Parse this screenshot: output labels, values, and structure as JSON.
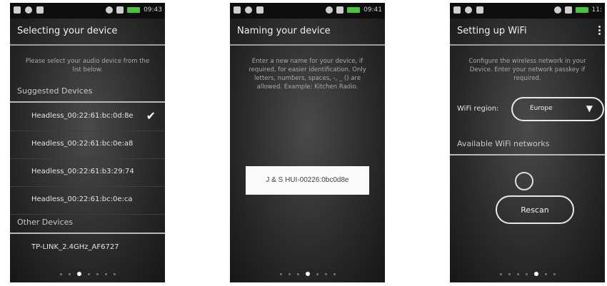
{
  "status_bar": {
    "time1": "09:43",
    "time2": "09:41",
    "time3": "11:"
  },
  "screen1": {
    "title": "Selecting your device",
    "description": "Please select your audio device from the list below.",
    "suggested_header": "Suggested Devices",
    "suggested_devices": [
      {
        "label": "Headless_00:22:61:bc:0d:8e",
        "selected": true
      },
      {
        "label": "Headless_00:22:61:bc:0e:a8",
        "selected": false
      },
      {
        "label": "Headless_00:22:61:b3:29:74",
        "selected": false
      },
      {
        "label": "Headless_00:22:61:bc:0e:ca",
        "selected": false
      }
    ],
    "other_header": "Other Devices",
    "other_devices": [
      {
        "label": "TP-LINK_2.4GHz_AF6727"
      }
    ],
    "page_index": 3,
    "page_count": 7
  },
  "screen2": {
    "title": "Naming your device",
    "description": "Enter a new name for your device, if required, for easier identification. Only letters, numbers, spaces, -, _ () are allowed. Example: Kitchen Radio.",
    "name_value": "J & S HUI-00226:0bc0d8e",
    "page_index": 4,
    "page_count": 7
  },
  "screen3": {
    "title": "Setting up WiFi",
    "description": "Configure the wireless network in your Device. Enter your network passkey if required.",
    "region_label": "WiFi region:",
    "region_value": "Europe",
    "networks_header": "Available WiFi networks",
    "rescan_label": "Rescan",
    "page_index": 5,
    "page_count": 7
  },
  "icons": {
    "check": "✔",
    "dropdown": "▼"
  },
  "colors": {
    "battery": "#49c43f",
    "background": "#2c2c2c",
    "accent": "#ffffff"
  }
}
